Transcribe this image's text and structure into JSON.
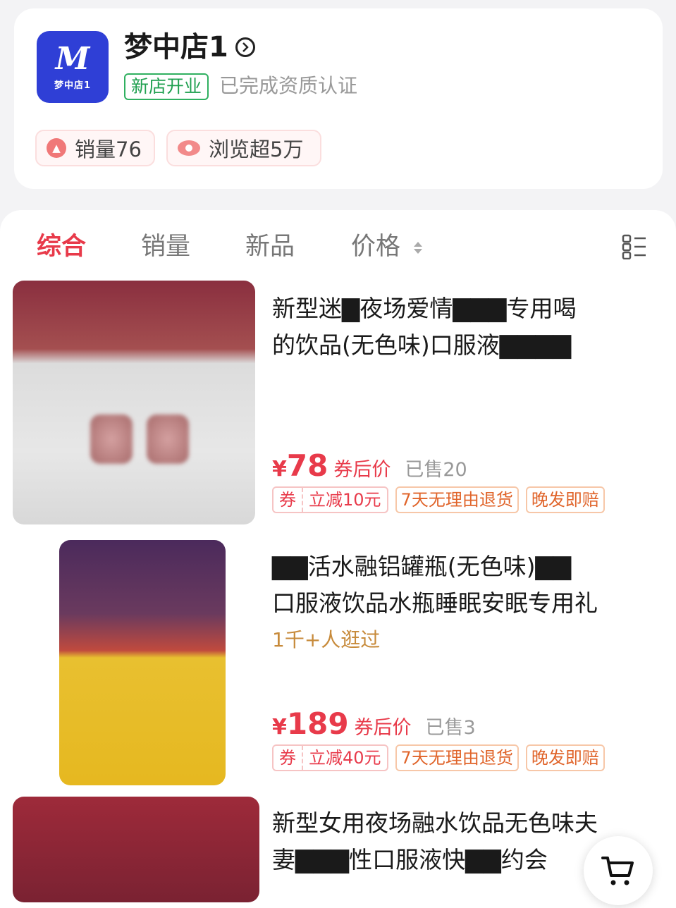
{
  "shop": {
    "logo_mark": "M",
    "logo_text": "梦中店1",
    "name": "梦中店1",
    "badge": "新店开业",
    "cert": "已完成资质认证",
    "stats": [
      {
        "icon": "sales-up-icon",
        "label": "销量76"
      },
      {
        "icon": "eye-icon",
        "label": "浏览超5万"
      }
    ]
  },
  "tabs": [
    {
      "label": "综合",
      "active": true
    },
    {
      "label": "销量"
    },
    {
      "label": "新品"
    },
    {
      "label": "价格"
    }
  ],
  "products": [
    {
      "title_lines": [
        "新型迷▇夜场爱情▇▇▇专用喝",
        "的饮品(无色味)口服液▇▇▇▇"
      ],
      "price_symbol": "¥",
      "price": "78",
      "price_note": "券后价",
      "sold": "已售20",
      "coupon_label": "券",
      "coupon_value": "立减10元",
      "tag1": "7天无理由退货",
      "tag2": "晚发即赔"
    },
    {
      "title_lines": [
        "▇▇活水融铝罐瓶(无色味)▇▇",
        "口服液饮品水瓶睡眠安眠专用礼"
      ],
      "browse": "1千+人逛过",
      "price_symbol": "¥",
      "price": "189",
      "price_note": "券后价",
      "sold": "已售3",
      "coupon_label": "券",
      "coupon_value": "立减40元",
      "tag1": "7天无理由退货",
      "tag2": "晚发即赔"
    },
    {
      "title_lines": [
        "新型女用夜场融水饮品无色味夫",
        "妻▇▇▇性口服液快▇▇约会"
      ]
    }
  ],
  "colors": {
    "accent": "#e83a4a",
    "logo_bg": "#2f3fd6",
    "badge_green": "#20a050"
  }
}
